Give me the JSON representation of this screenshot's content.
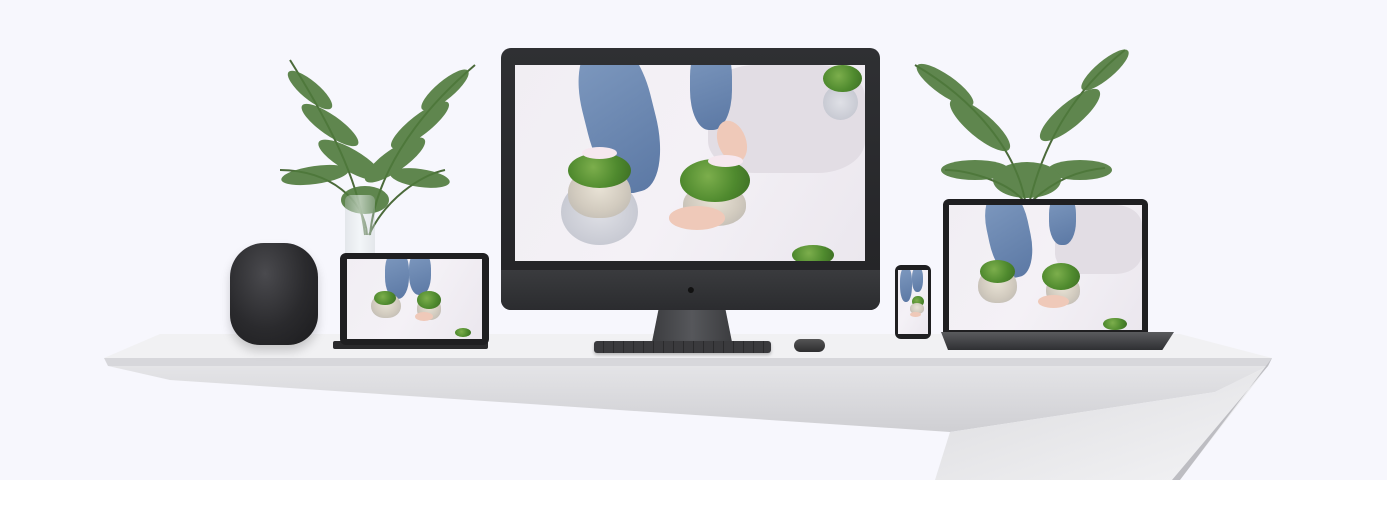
{
  "scene": {
    "background_color": "#f7f7fd",
    "devices": [
      "homepod-speaker",
      "ipad",
      "imac",
      "iphone",
      "macbook"
    ],
    "accent_colors": {
      "sleeve_blue": "#6f89b3",
      "leaf_green": "#4f8a2e",
      "device_gray": "#2b2c2f",
      "shelf_white": "#f0f0f2"
    }
  }
}
